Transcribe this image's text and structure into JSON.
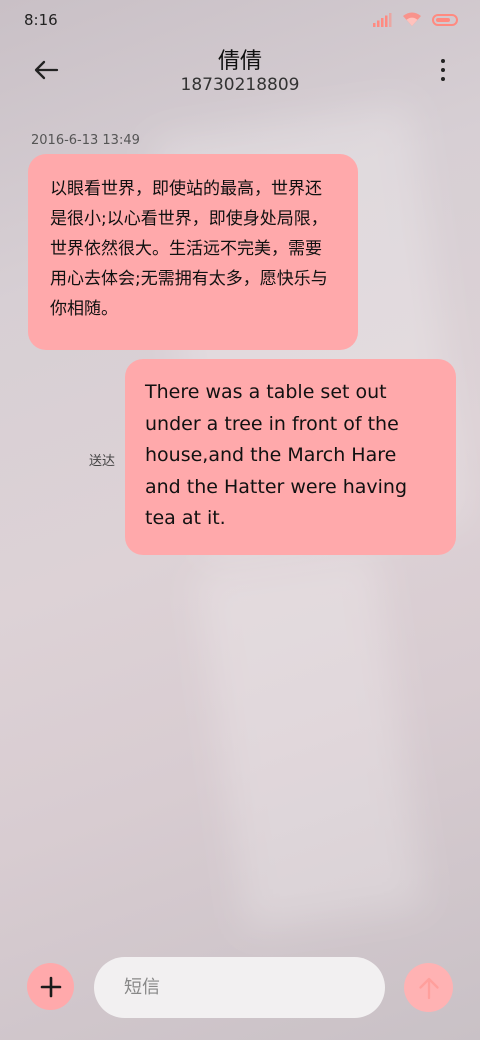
{
  "status_bar": {
    "time": "8:16",
    "icons": [
      "signal-icon",
      "wifi-icon",
      "battery-icon"
    ],
    "icon_color": "#ff8a80"
  },
  "header": {
    "back_icon": "arrow-left-icon",
    "contact_name": "倩倩",
    "contact_number": "18730218809",
    "more_icon": "more-vertical-icon"
  },
  "conversation": {
    "timestamp": "2016-6-13 13:49",
    "messages": [
      {
        "direction": "incoming",
        "text": "以眼看世界，即使站的最高，世界还是很小;以心看世界，即使身处局限，世界依然很大。生活远不完美，需要用心去体会;无需拥有太多，愿快乐与你相随。"
      },
      {
        "direction": "outgoing",
        "text": "There was a table set out under a tree in front of the house,and the March Hare and the Hatter were having tea at it.",
        "status": "送达"
      }
    ],
    "bubble_color": "#ffa9ab"
  },
  "composer": {
    "add_icon": "plus-icon",
    "input_value": "",
    "input_placeholder": "短信",
    "send_icon": "arrow-up-icon"
  }
}
